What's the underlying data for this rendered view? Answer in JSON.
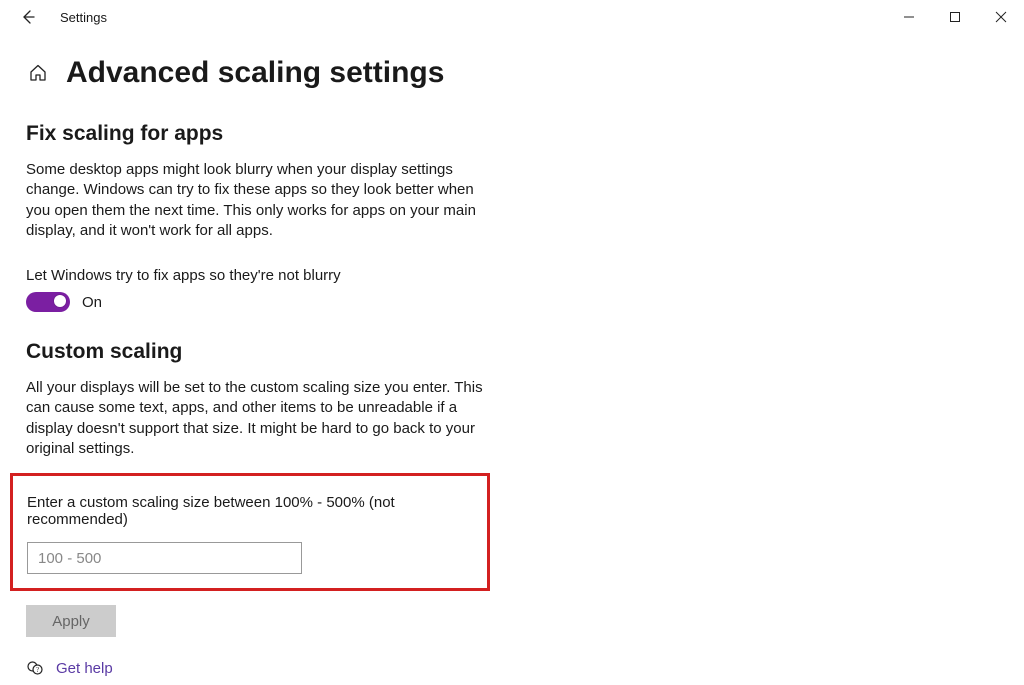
{
  "titlebar": {
    "app_name": "Settings"
  },
  "header": {
    "page_title": "Advanced scaling settings"
  },
  "fix_scaling": {
    "section_title": "Fix scaling for apps",
    "description": "Some desktop apps might look blurry when your display settings change. Windows can try to fix these apps so they look better when you open them the next time. This only works for apps on your main display, and it won't work for all apps.",
    "toggle_label": "Let Windows try to fix apps so they're not blurry",
    "toggle_state": "On"
  },
  "custom_scaling": {
    "section_title": "Custom scaling",
    "description": "All your displays will be set to the custom scaling size you enter. This can cause some text, apps, and other items to be unreadable if a display doesn't support that size. It might be hard to go back to your original settings.",
    "input_label": "Enter a custom scaling size between 100% - 500% (not recommended)",
    "input_placeholder": "100 - 500",
    "apply_label": "Apply"
  },
  "footer": {
    "help_label": "Get help"
  }
}
